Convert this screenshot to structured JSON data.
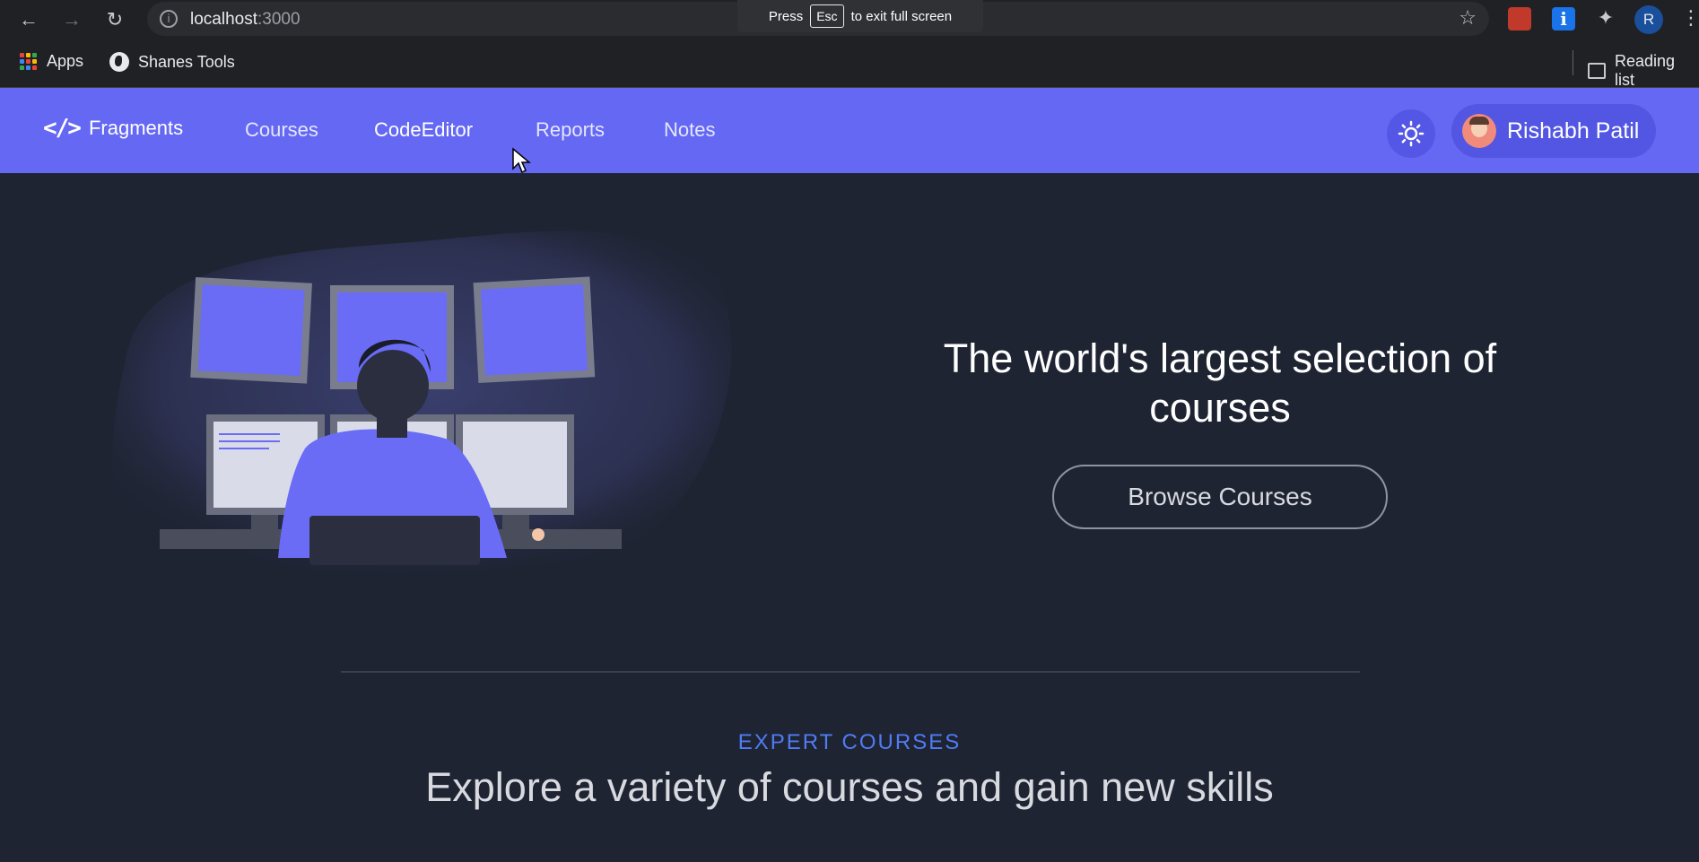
{
  "browser": {
    "url_host": "localhost",
    "url_port": ":3000",
    "fullscreen_notice": {
      "pre": "Press",
      "key": "Esc",
      "post": "to exit full screen"
    },
    "profile_initial": "R",
    "bookmarks": {
      "apps": "Apps",
      "tools": "Shanes Tools",
      "reading_list": "Reading list"
    }
  },
  "navbar": {
    "brand": "Fragments",
    "links": [
      "Courses",
      "CodeEditor",
      "Reports",
      "Notes"
    ],
    "user_name": "Rishabh Patil"
  },
  "hero": {
    "title_line1": "The world's largest selection of",
    "title_line2": "courses",
    "cta": "Browse Courses"
  },
  "section": {
    "eyebrow": "EXPERT COURSES",
    "title": "Explore a variety of courses and gain new skills"
  },
  "colors": {
    "nav_bg": "#6468f2",
    "page_bg": "#1f2433",
    "accent": "#4f7bf5"
  }
}
